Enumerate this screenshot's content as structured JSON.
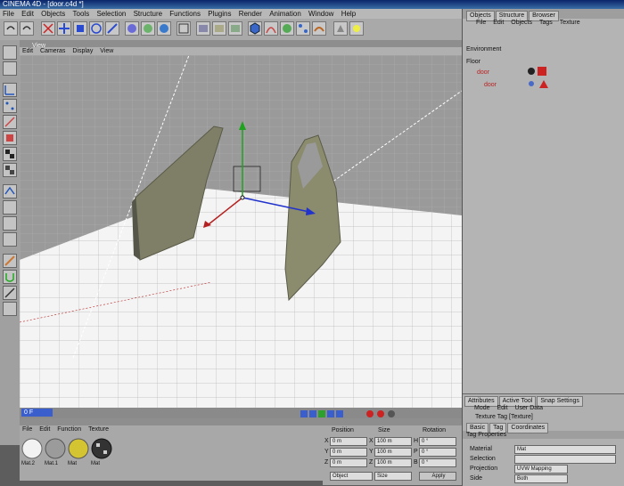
{
  "window": {
    "title": "CINEMA 4D - [door.c4d *]"
  },
  "menu": [
    "File",
    "Edit",
    "Objects",
    "Tools",
    "Selection",
    "Structure",
    "Functions",
    "Plugins",
    "Render",
    "Animation",
    "Window",
    "Help"
  ],
  "viewport": {
    "title": "View",
    "menu": [
      "Edit",
      "Cameras",
      "Display",
      "View"
    ]
  },
  "timeline": {
    "frame": "0 F"
  },
  "object_manager": {
    "tabs": [
      "Objects",
      "Structure",
      "Browser"
    ],
    "menu": [
      "File",
      "Edit",
      "Objects",
      "Tags",
      "Texture"
    ],
    "items": [
      {
        "name": "Environment",
        "indent": 0
      },
      {
        "name": "Floor",
        "indent": 0
      },
      {
        "name": "door",
        "indent": 1
      },
      {
        "name": "door",
        "indent": 2
      }
    ]
  },
  "attributes": {
    "tabs": [
      "Attributes",
      "Active Tool",
      "Snap Settings"
    ],
    "menu": [
      "Mode",
      "Edit",
      "User Data"
    ],
    "object_title": "Texture Tag [Texture]",
    "subtabs": [
      "Basic",
      "Tag",
      "Coordinates"
    ],
    "section": "Tag Properties",
    "rows": [
      {
        "label": "Material",
        "value": "Mat"
      },
      {
        "label": "Selection",
        "value": ""
      },
      {
        "label": "Projection",
        "value": "UVW Mapping"
      },
      {
        "label": "Side",
        "value": "Both"
      }
    ]
  },
  "materials": {
    "menu": [
      "File",
      "Edit",
      "Function",
      "Texture"
    ],
    "items": [
      {
        "name": "Mat.2",
        "color": "#f2f2f2"
      },
      {
        "name": "Mat.1",
        "color": "#9b9b9b"
      },
      {
        "name": "Mat",
        "color": "#d4c431"
      },
      {
        "name": "Mat",
        "color": "#333333"
      }
    ]
  },
  "coordinates": {
    "headers": [
      "Position",
      "Size",
      "Rotation"
    ],
    "rows": [
      {
        "axis": "X",
        "pos": "0 m",
        "size": "100 m",
        "rot": "0 °",
        "size_axis": "X",
        "rot_axis": "H"
      },
      {
        "axis": "Y",
        "pos": "0 m",
        "size": "100 m",
        "rot": "0 °",
        "size_axis": "Y",
        "rot_axis": "P"
      },
      {
        "axis": "Z",
        "pos": "0 m",
        "size": "100 m",
        "rot": "0 °",
        "size_axis": "Z",
        "rot_axis": "B"
      }
    ],
    "mode": "Object",
    "size_mode": "Size",
    "apply": "Apply"
  },
  "colors": {
    "viewport_floor": "#f4f4f4",
    "grid_sky": "#9a9a9a",
    "door": "#8b8b6e"
  }
}
